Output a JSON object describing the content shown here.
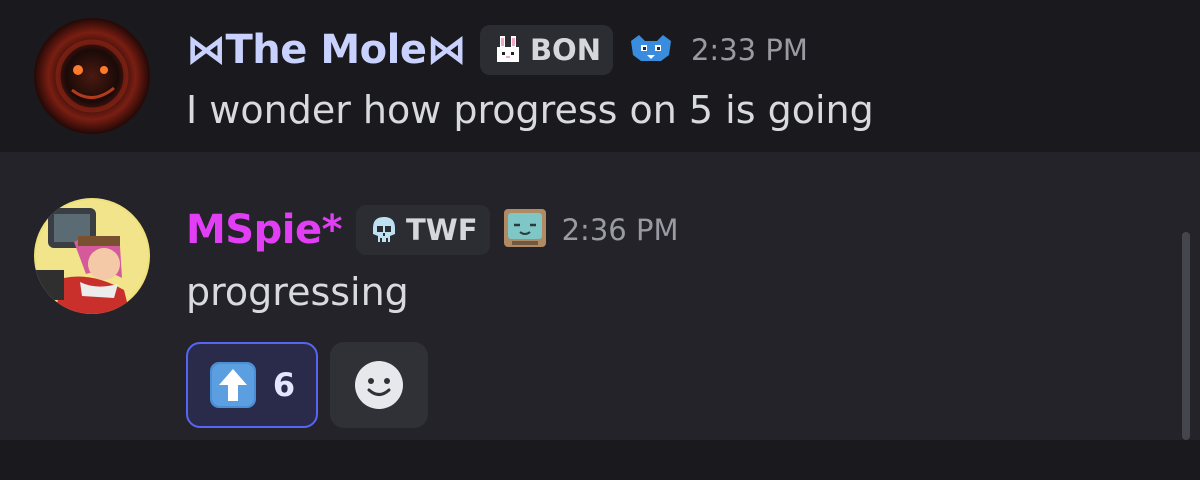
{
  "messages": [
    {
      "username": "⋈The Mole⋈",
      "tag": "BON",
      "tag_icon": "bunny-icon",
      "role_icon": "blue-creature-icon",
      "timestamp": "2:33 PM",
      "content": "I wonder how progress on 5 is going",
      "name_color": "#c9d2ff"
    },
    {
      "username": "MSpie*",
      "tag": "TWF",
      "tag_icon": "skull-icon",
      "role_icon": "tv-face-icon",
      "timestamp": "2:36 PM",
      "content": "progressing",
      "name_color": "#e23ef5",
      "reactions": [
        {
          "emoji": "up-arrow-icon",
          "count": "6",
          "selected": true
        }
      ]
    }
  ],
  "colors": {
    "background": "#1a1a1e",
    "hover_background": "#232329",
    "accent": "#5865f2",
    "timestamp": "#9a9ba2"
  }
}
